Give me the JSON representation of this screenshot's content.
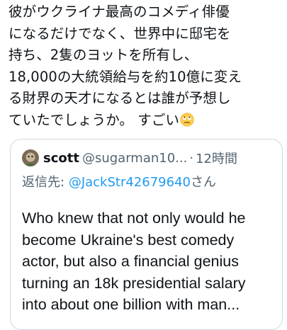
{
  "post": {
    "text": "彼がウクライナ最高のコメディ俳優\nになるだけでなく、世界中に邸宅を\n持ち、2隻のヨットを所有し、\n18,000の大統領給与を約10億に変え\nる財界の天才になるとは誰が予想し\nていたでしょうか。 すごい",
    "emoji": "face-with-rolling-eyes-emoji"
  },
  "quote": {
    "avatar": "user-avatar",
    "display_name": "scott",
    "handle": "@sugarman10...",
    "separator": "·",
    "time": "12時間",
    "reply_prefix": "返信先:",
    "reply_handle": "@JackStr42679640",
    "reply_suffix": "さん",
    "text": "Who knew that not only would he\nbecome Ukraine's best comedy\nactor, but also a financial genius\nturning an 18k presidential salary\ninto about one billion with man..."
  },
  "colors": {
    "text_primary": "#0f1419",
    "text_secondary": "#536471",
    "link": "#1d9bf0",
    "border": "#cfd9de"
  }
}
